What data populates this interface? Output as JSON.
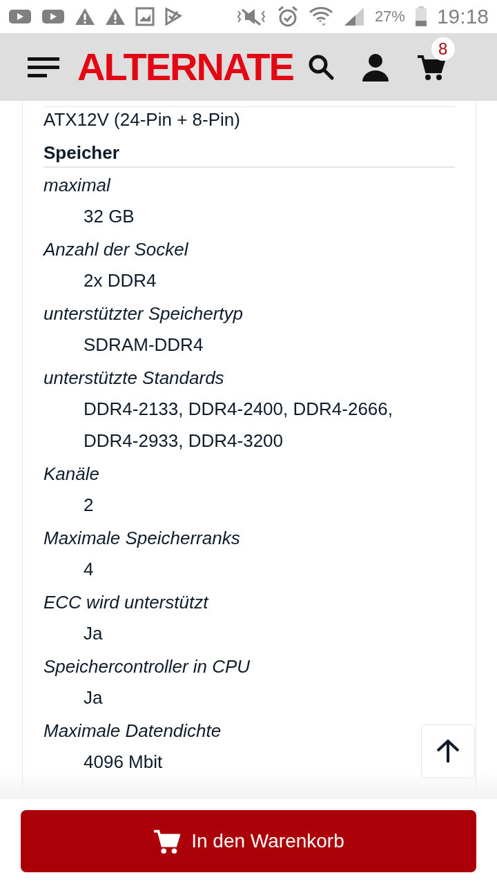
{
  "status_bar": {
    "battery_percent": "27%",
    "time": "19:18"
  },
  "header": {
    "logo": "ALTERNATE",
    "cart_count": "8"
  },
  "specs": {
    "intro_value": "ATX12V (24-Pin + 8-Pin)",
    "section": "Speicher",
    "items": [
      {
        "label": "maximal",
        "values": [
          "32 GB"
        ]
      },
      {
        "label": "Anzahl der Sockel",
        "values": [
          "2x DDR4"
        ]
      },
      {
        "label": "unterstützter Speichertyp",
        "values": [
          "SDRAM-DDR4"
        ]
      },
      {
        "label": "unterstützte Standards",
        "values": [
          "DDR4-2133, DDR4-2400, DDR4-2666,",
          "DDR4-2933, DDR4-3200"
        ]
      },
      {
        "label": "Kanäle",
        "values": [
          "2"
        ]
      },
      {
        "label": "Maximale Speicherranks",
        "values": [
          "4"
        ]
      },
      {
        "label": "ECC wird unterstützt",
        "values": [
          "Ja"
        ]
      },
      {
        "label": "Speichercontroller in CPU",
        "values": [
          "Ja"
        ]
      },
      {
        "label": "Maximale Datendichte",
        "values": [
          "4096 Mbit"
        ]
      }
    ]
  },
  "add_to_cart_button": {
    "label": "In den Warenkorb"
  }
}
